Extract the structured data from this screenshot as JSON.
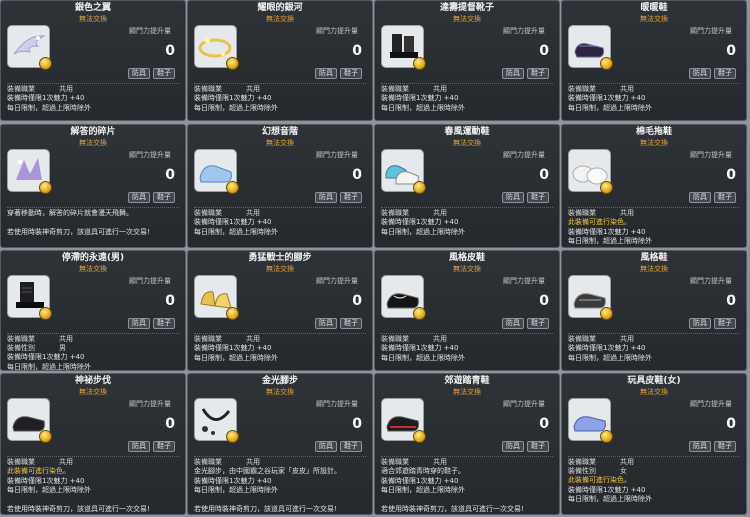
{
  "power_label": "顯門力提升量",
  "armor_tag": "防具",
  "shoes_tag": "鞋子",
  "untradeable": "無法交換",
  "equip_job_label": "裝備職業",
  "equip_gender_label": "裝備性別",
  "cards": [
    {
      "title": "銀色之翼",
      "power": "0",
      "job": "共用",
      "gender": "",
      "lines": [
        "裝備時僅限1次魅力 +40",
        "每日限制，超過上限時除外",
        "",
        "若使用時裝神奇剪刀，該道具可進行一次交易!"
      ],
      "desc": "",
      "icon": "silver-wing-icon",
      "bg": "#dfe4ea"
    },
    {
      "title": "耀眼的銀河",
      "power": "0",
      "job": "共用",
      "gender": "",
      "lines": [
        "裝備時僅限1次魅力 +40",
        "每日限制，超過上限時除外",
        "",
        "若使用時裝神奇剪刀，該道具可進行一次交易!"
      ],
      "desc": "",
      "icon": "galaxy-icon",
      "bg": "#f1ecd9"
    },
    {
      "title": "達壽提督靴子",
      "power": "0",
      "job": "共用",
      "gender": "",
      "lines": [
        "裝備時僅限1次魅力 +40",
        "每日限制，超過上限時除外",
        "",
        "若使用時裝神奇剪刀，該道具可進行一次交易!"
      ],
      "desc": "",
      "icon": "black-boots-icon",
      "bg": "#e6e9ec"
    },
    {
      "title": "暖暖鞋",
      "power": "0",
      "job": "共用",
      "gender": "",
      "lines": [
        "裝備時僅限1次魅力 +40",
        "每日限制，超過上限時除外",
        "",
        "若使用時裝神奇剪刀，該道具可進行一次交易!"
      ],
      "desc": "",
      "icon": "purple-shoes-icon",
      "bg": "#e6e9ec"
    },
    {
      "title": "解答的碎片",
      "power": "0",
      "job": "",
      "gender": "",
      "lines": [
        "穿著移動時，解答的碎片就會漫天飛舞。",
        "",
        "若使用時裝神奇剪刀，該道具可進行一次交易!"
      ],
      "desc": "",
      "icon": "shard-icon",
      "bg": "#e3e0ee"
    },
    {
      "title": "幻想音階",
      "power": "0",
      "job": "共用",
      "gender": "",
      "lines": [
        "裝備時僅限1次魅力 +40",
        "每日限制，超過上限時除外",
        "",
        "若使用時裝神奇剪刀，該道具可進行一次交易!"
      ],
      "desc": "",
      "icon": "blue-shoes-icon",
      "bg": "#e6e9ec"
    },
    {
      "title": "春風運動鞋",
      "power": "0",
      "job": "共用",
      "gender": "",
      "lines": [
        "裝備時僅限1次魅力 +40",
        "每日限制，超過上限時除外",
        "",
        "若使用時裝神奇剪刀，該道具可進行一次交易!"
      ],
      "desc": "",
      "icon": "sneakers-icon",
      "bg": "#e6e9ec"
    },
    {
      "title": "棉毛拖鞋",
      "power": "0",
      "job": "共用",
      "gender": "",
      "lines": [
        "此裝備可進行染色。",
        "裝備時僅限1次魅力 +40",
        "每日限制，超過上限時除外",
        "",
        "若使用時裝神奇剪刀，該道具可進行一次交易!"
      ],
      "desc": "",
      "icon": "slippers-icon",
      "bg": "#e6e9ec"
    },
    {
      "title": "停滯的永遠(男)",
      "power": "0",
      "job": "共用",
      "gender": "男",
      "lines": [
        "裝備時僅限1次魅力 +40",
        "每日限制，超過上限時除外",
        "",
        "若使用時裝神奇剪刀，該道具可進行一次交易!"
      ],
      "desc": "",
      "icon": "dark-boots-icon",
      "bg": "#e6e9ec"
    },
    {
      "title": "勇猛戰士的腳步",
      "power": "0",
      "job": "共用",
      "gender": "",
      "lines": [
        "裝備時僅限1次魅力 +40",
        "每日限制，超過上限時除外",
        "",
        "若使用時裝神奇剪刀，該道具可進行一次交易!"
      ],
      "desc": "",
      "icon": "gold-shoes-icon",
      "bg": "#f1ecd9"
    },
    {
      "title": "風格皮鞋",
      "power": "0",
      "job": "共用",
      "gender": "",
      "lines": [
        "裝備時僅限1次魅力 +40",
        "每日限制，超過上限時除外",
        "",
        "若使用時裝神奇剪刀，該道具可進行一次交易!"
      ],
      "desc": "",
      "icon": "loafer-icon",
      "bg": "#e6e9ec"
    },
    {
      "title": "風格鞋",
      "power": "0",
      "job": "共用",
      "gender": "",
      "lines": [
        "裝備時僅限1次魅力 +40",
        "每日限制，超過上限時除外",
        "",
        "若使用時裝神奇剪刀，該道具可進行一次交易!"
      ],
      "desc": "",
      "icon": "grey-shoes-icon",
      "bg": "#e6e9ec"
    },
    {
      "title": "神祕步伐",
      "power": "0",
      "job": "共用",
      "gender": "",
      "lines": [
        "此裝備可進行染色。",
        "裝備時僅限1次魅力 +40",
        "每日限制，超過上限時除外",
        "",
        "若使用時裝神奇剪刀，該道具可進行一次交易!"
      ],
      "desc": "",
      "icon": "mystic-shoes-icon",
      "bg": "#e6e9ec"
    },
    {
      "title": "金光腳步",
      "power": "0",
      "job": "共用",
      "gender": "",
      "lines": [
        "金光腳步，由中國霸之谷玩家「皮皮」所設計。",
        "裝備時僅限1次魅力 +40",
        "每日限制，超過上限時除外",
        "",
        "若使用時裝神奇剪刀，該道具可進行一次交易!"
      ],
      "desc": "",
      "icon": "chain-icon",
      "bg": "#e6e9ec"
    },
    {
      "title": "郊遊踏青鞋",
      "power": "0",
      "job": "共用",
      "gender": "",
      "lines": [
        "適合郊遊踏青時穿的鞋子。",
        "裝備時僅限1次魅力 +40",
        "每日限制，超過上限時除外",
        "",
        "若使用時裝神奇剪刀，該道具可進行一次交易!"
      ],
      "desc": "",
      "icon": "red-shoes-icon",
      "bg": "#e6e9ec"
    },
    {
      "title": "玩具皮鞋(女)",
      "power": "0",
      "job": "共用",
      "gender": "女",
      "lines": [
        "此裝備可進行染色。",
        "裝備時僅限1次魅力 +40",
        "每日限制，超過上限時除外",
        "",
        "若使用時裝神奇剪刀，該道具可進行一次交易!"
      ],
      "desc": "",
      "icon": "toy-shoes-icon",
      "bg": "#e6e9ec"
    }
  ]
}
